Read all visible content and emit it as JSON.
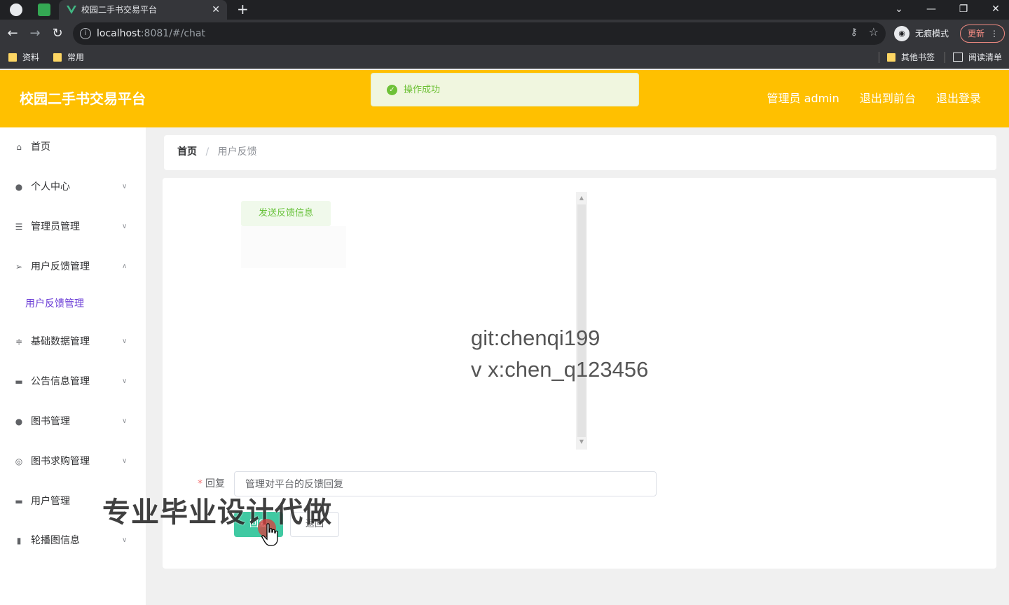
{
  "browser": {
    "tab_title": "校园二手书交易平台",
    "tab_close": "✕",
    "new_tab": "+",
    "url_host": "localhost",
    "url_rest": ":8081/#/chat",
    "incognito_label": "无痕模式",
    "update_label": "更新",
    "bookmarks": [
      "资料",
      "常用"
    ],
    "other_bookmarks": "其他书签",
    "reading_list": "阅读清单"
  },
  "header": {
    "title": "校园二手书交易平台",
    "user_label": "管理员 admin",
    "to_front": "退出到前台",
    "logout": "退出登录"
  },
  "toast": {
    "message": "操作成功"
  },
  "sidebar": {
    "items": [
      {
        "label": "首页",
        "icon": "home-icon"
      },
      {
        "label": "个人中心",
        "icon": "user-icon"
      },
      {
        "label": "管理员管理",
        "icon": "list-icon"
      },
      {
        "label": "用户反馈管理",
        "icon": "send-icon"
      },
      {
        "label": "基础数据管理",
        "icon": "sliders-icon"
      },
      {
        "label": "公告信息管理",
        "icon": "monitor-icon"
      },
      {
        "label": "图书管理",
        "icon": "user-icon"
      },
      {
        "label": "图书求购管理",
        "icon": "circle-icon"
      },
      {
        "label": "用户管理",
        "icon": "monitor-icon"
      },
      {
        "label": "轮播图信息",
        "icon": "bars-icon"
      }
    ],
    "sub_item": "用户反馈管理"
  },
  "breadcrumb": {
    "home": "首页",
    "separator": "/",
    "current": "用户反馈"
  },
  "chat": {
    "bubble": "发送反馈信息"
  },
  "overlay": {
    "git_line": "git:chenqi199",
    "wx_line": "v x:chen_q123456",
    "promo": "专业毕业设计代做"
  },
  "form": {
    "reply_label": "回复",
    "required_mark": "*",
    "reply_value": "管理对平台的反馈回复",
    "reply_button": "回复",
    "back_button": "返回"
  },
  "colors": {
    "header_bg": "#ffc000",
    "accent": "#40c9a2",
    "success": "#67c23a",
    "sub_active": "#6a3bd6"
  }
}
